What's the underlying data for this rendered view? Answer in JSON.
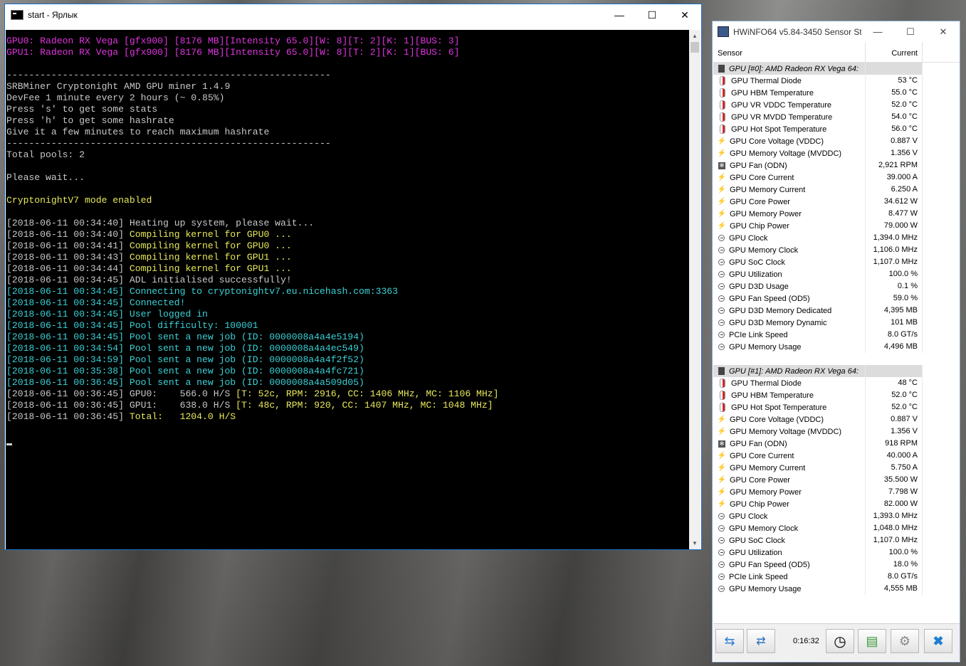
{
  "console": {
    "title": "start - Ярлык",
    "minimize": "—",
    "maximize": "☐",
    "close": "✕",
    "lines": [
      {
        "t": "GPU0: Radeon RX Vega [gfx900] [8176 MB][Intensity 65.0][W: 8][T: 2][K: 1][BUS: 3]",
        "c": "magenta"
      },
      {
        "t": "GPU1: Radeon RX Vega [gfx900] [8176 MB][Intensity 65.0][W: 8][T: 2][K: 1][BUS: 6]",
        "c": "magenta"
      },
      {
        "t": "",
        "c": "white"
      },
      {
        "t": "----------------------------------------------------------",
        "c": "white"
      },
      {
        "t": "SRBMiner Cryptonight AMD GPU miner 1.4.9",
        "c": "white"
      },
      {
        "t": "DevFee 1 minute every 2 hours (~ 0.85%)",
        "c": "white"
      },
      {
        "t": "Press 's' to get some stats",
        "c": "white"
      },
      {
        "t": "Press 'h' to get some hashrate",
        "c": "white"
      },
      {
        "t": "Give it a few minutes to reach maximum hashrate",
        "c": "white"
      },
      {
        "t": "----------------------------------------------------------",
        "c": "white"
      },
      {
        "t": "Total pools: 2",
        "c": "white"
      },
      {
        "t": "",
        "c": "white"
      },
      {
        "t": "Please wait...",
        "c": "white"
      },
      {
        "t": "",
        "c": "white"
      },
      {
        "t": "CryptonightV7 mode enabled",
        "c": "yellow"
      },
      {
        "t": "",
        "c": "white"
      },
      {
        "t": "[2018-06-11 00:34:40] Heating up system, please wait...",
        "c": "white"
      },
      {
        "ts": "[2018-06-11 00:34:40]",
        "t": " Compiling kernel for GPU0 ...",
        "tsc": "white",
        "c": "yellow"
      },
      {
        "ts": "[2018-06-11 00:34:41]",
        "t": " Compiling kernel for GPU0 ...",
        "tsc": "white",
        "c": "yellow"
      },
      {
        "ts": "[2018-06-11 00:34:43]",
        "t": " Compiling kernel for GPU1 ...",
        "tsc": "white",
        "c": "yellow"
      },
      {
        "ts": "[2018-06-11 00:34:44]",
        "t": " Compiling kernel for GPU1 ...",
        "tsc": "white",
        "c": "yellow"
      },
      {
        "t": "[2018-06-11 00:34:45] ADL initialised successfully!",
        "c": "white"
      },
      {
        "t": "[2018-06-11 00:34:45] Connecting to cryptonightv7.eu.nicehash.com:3363",
        "c": "cyan"
      },
      {
        "t": "[2018-06-11 00:34:45] Connected!",
        "c": "cyan"
      },
      {
        "t": "[2018-06-11 00:34:45] User logged in",
        "c": "cyan"
      },
      {
        "t": "[2018-06-11 00:34:45] Pool difficulty: 100001",
        "c": "cyan"
      },
      {
        "t": "[2018-06-11 00:34:45] Pool sent a new job (ID: 0000008a4a4e5194)",
        "c": "cyan"
      },
      {
        "t": "[2018-06-11 00:34:54] Pool sent a new job (ID: 0000008a4a4ec549)",
        "c": "cyan"
      },
      {
        "t": "[2018-06-11 00:34:59] Pool sent a new job (ID: 0000008a4a4f2f52)",
        "c": "cyan"
      },
      {
        "t": "[2018-06-11 00:35:38] Pool sent a new job (ID: 0000008a4a4fc721)",
        "c": "cyan"
      },
      {
        "t": "[2018-06-11 00:36:45] Pool sent a new job (ID: 0000008a4a509d05)",
        "c": "cyan"
      },
      {
        "ts": "[2018-06-11 00:36:45] GPU0:    566.0 H/S",
        "t": " [T: 52c, RPM: 2916, CC: 1406 MHz, MC: 1106 MHz]",
        "tsc": "white",
        "c": "yellow"
      },
      {
        "ts": "[2018-06-11 00:36:45] GPU1:    638.0 H/S",
        "t": " [T: 48c, RPM: 920, CC: 1407 MHz, MC: 1048 MHz]",
        "tsc": "white",
        "c": "yellow"
      },
      {
        "ts": "[2018-06-11 00:36:45]",
        "t": " Total:   1204.0 H/S",
        "tsc": "white",
        "c": "yellow"
      }
    ]
  },
  "hwinfo": {
    "title": "HWiNFO64 v5.84-3450 Sensor St...",
    "minimize": "—",
    "maximize": "☐",
    "close": "✕",
    "col_sensor": "Sensor",
    "col_current": "Current",
    "groups": [
      {
        "name": "GPU [#0]: AMD Radeon RX Vega 64:",
        "rows": [
          {
            "icon": "temp",
            "name": "GPU Thermal Diode",
            "value": "53 °C"
          },
          {
            "icon": "temp",
            "name": "GPU HBM Temperature",
            "value": "55.0 °C"
          },
          {
            "icon": "temp",
            "name": "GPU VR VDDC Temperature",
            "value": "52.0 °C"
          },
          {
            "icon": "temp",
            "name": "GPU VR MVDD Temperature",
            "value": "54.0 °C"
          },
          {
            "icon": "temp",
            "name": "GPU Hot Spot Temperature",
            "value": "56.0 °C"
          },
          {
            "icon": "volt",
            "name": "GPU Core Voltage (VDDC)",
            "value": "0.887 V"
          },
          {
            "icon": "volt",
            "name": "GPU Memory Voltage (MVDDC)",
            "value": "1.356 V"
          },
          {
            "icon": "fan",
            "name": "GPU Fan (ODN)",
            "value": "2,921 RPM"
          },
          {
            "icon": "volt",
            "name": "GPU Core Current",
            "value": "39.000 A"
          },
          {
            "icon": "volt",
            "name": "GPU Memory Current",
            "value": "6.250 A"
          },
          {
            "icon": "volt",
            "name": "GPU Core Power",
            "value": "34.612 W"
          },
          {
            "icon": "volt",
            "name": "GPU Memory Power",
            "value": "8.477 W"
          },
          {
            "icon": "volt",
            "name": "GPU Chip Power",
            "value": "79.000 W"
          },
          {
            "icon": "clock",
            "name": "GPU Clock",
            "value": "1,394.0 MHz"
          },
          {
            "icon": "clock",
            "name": "GPU Memory Clock",
            "value": "1,106.0 MHz"
          },
          {
            "icon": "clock",
            "name": "GPU SoC Clock",
            "value": "1,107.0 MHz"
          },
          {
            "icon": "clock",
            "name": "GPU Utilization",
            "value": "100.0 %"
          },
          {
            "icon": "clock",
            "name": "GPU D3D Usage",
            "value": "0.1 %"
          },
          {
            "icon": "clock",
            "name": "GPU Fan Speed (OD5)",
            "value": "59.0 %"
          },
          {
            "icon": "clock",
            "name": "GPU D3D Memory Dedicated",
            "value": "4,395 MB"
          },
          {
            "icon": "clock",
            "name": "GPU D3D Memory Dynamic",
            "value": "101 MB"
          },
          {
            "icon": "clock",
            "name": "PCIe Link Speed",
            "value": "8.0 GT/s"
          },
          {
            "icon": "clock",
            "name": "GPU Memory Usage",
            "value": "4,496 MB"
          }
        ]
      },
      {
        "name": "GPU [#1]: AMD Radeon RX Vega 64:",
        "rows": [
          {
            "icon": "temp",
            "name": "GPU Thermal Diode",
            "value": "48 °C"
          },
          {
            "icon": "temp",
            "name": "GPU HBM Temperature",
            "value": "52.0 °C"
          },
          {
            "icon": "temp",
            "name": "GPU Hot Spot Temperature",
            "value": "52.0 °C"
          },
          {
            "icon": "volt",
            "name": "GPU Core Voltage (VDDC)",
            "value": "0.887 V"
          },
          {
            "icon": "volt",
            "name": "GPU Memory Voltage (MVDDC)",
            "value": "1.356 V"
          },
          {
            "icon": "fan",
            "name": "GPU Fan (ODN)",
            "value": "918 RPM"
          },
          {
            "icon": "volt",
            "name": "GPU Core Current",
            "value": "40.000 A"
          },
          {
            "icon": "volt",
            "name": "GPU Memory Current",
            "value": "5.750 A"
          },
          {
            "icon": "volt",
            "name": "GPU Core Power",
            "value": "35.500 W"
          },
          {
            "icon": "volt",
            "name": "GPU Memory Power",
            "value": "7.798 W"
          },
          {
            "icon": "volt",
            "name": "GPU Chip Power",
            "value": "82.000 W"
          },
          {
            "icon": "clock",
            "name": "GPU Clock",
            "value": "1,393.0 MHz"
          },
          {
            "icon": "clock",
            "name": "GPU Memory Clock",
            "value": "1,048.0 MHz"
          },
          {
            "icon": "clock",
            "name": "GPU SoC Clock",
            "value": "1,107.0 MHz"
          },
          {
            "icon": "clock",
            "name": "GPU Utilization",
            "value": "100.0 %"
          },
          {
            "icon": "clock",
            "name": "GPU Fan Speed (OD5)",
            "value": "18.0 %"
          },
          {
            "icon": "clock",
            "name": "PCIe Link Speed",
            "value": "8.0 GT/s"
          },
          {
            "icon": "clock",
            "name": "GPU Memory Usage",
            "value": "4,555 MB"
          }
        ]
      }
    ],
    "elapsed": "0:16:32",
    "toolbar_icons": [
      "arrows-icon",
      "network-icon",
      "clock-icon",
      "report-add-icon",
      "settings-gear-icon",
      "close-x-icon"
    ]
  }
}
